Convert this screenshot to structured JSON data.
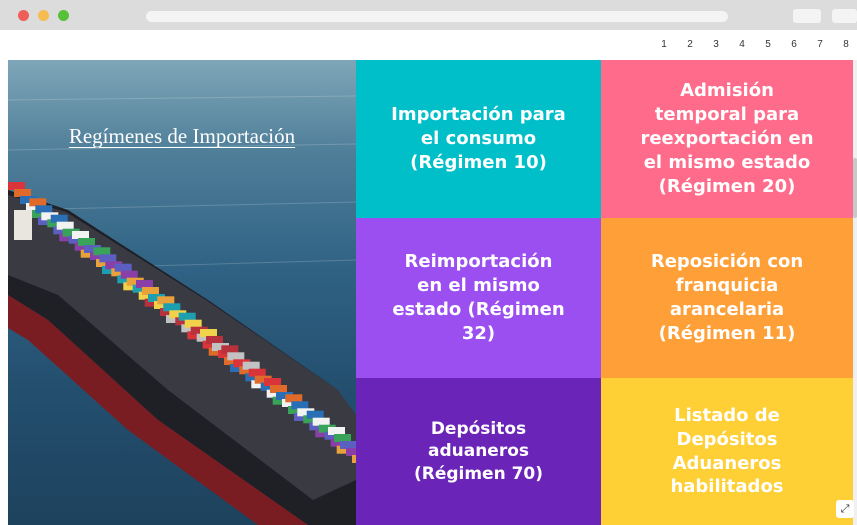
{
  "pagination": {
    "pages": [
      "1",
      "2",
      "3",
      "4",
      "5",
      "6",
      "7",
      "8"
    ]
  },
  "hero": {
    "title": "Regímenes de Importación"
  },
  "tiles": [
    {
      "label": "Importación para\nel consumo\n(Régimen 10)",
      "color": "#00bfc8"
    },
    {
      "label": "Admisión\ntemporal para\nreexportación en\nel mismo estado\n(Régimen 20)",
      "color": "#ff6b8a"
    },
    {
      "label": "Reimportación\nen el mismo\nestado (Régimen\n32)",
      "color": "#9b4ff0"
    },
    {
      "label": "Reposición con\nfranquicia\narancelaria\n(Régimen 11)",
      "color": "#ff9f37"
    },
    {
      "label": "Depósitos aduaneros\n(Régimen 70)",
      "color": "#6a24b8"
    },
    {
      "label": "Listado de\nDepósitos\nAduaneros\nhabilitados",
      "color": "#ffd035"
    }
  ],
  "icons": {
    "expand": "expand-icon"
  }
}
